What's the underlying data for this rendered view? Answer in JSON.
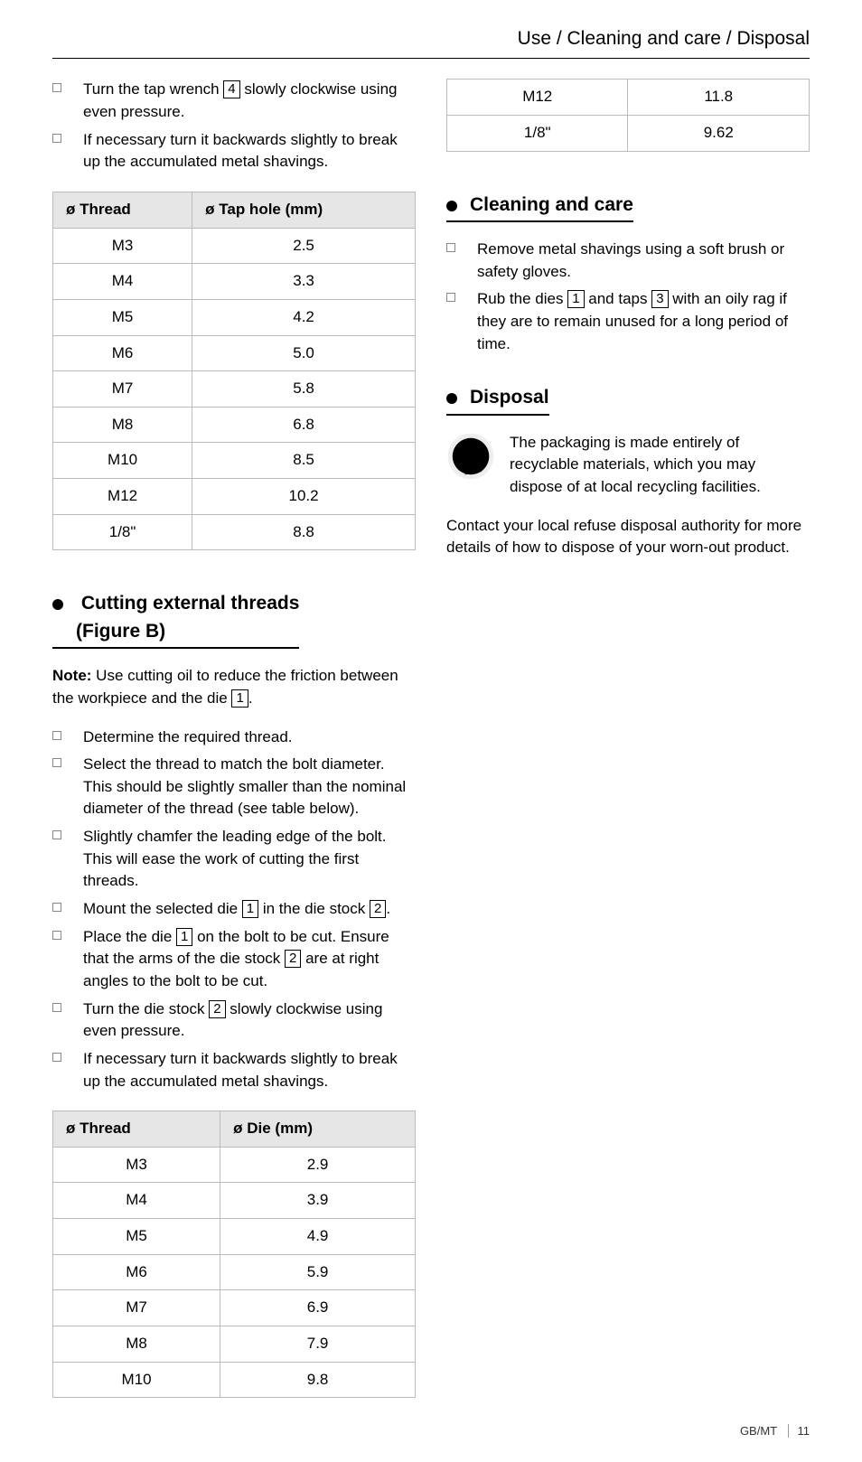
{
  "header": "Use / Cleaning and care / Disposal",
  "intro_items": [
    {
      "pre": "Turn the tap wrench ",
      "ref": "4",
      "post": " slowly clockwise using even pressure."
    },
    {
      "pre": "If necessary turn it backwards slightly to break up the accumulated metal shavings.",
      "ref": "",
      "post": ""
    }
  ],
  "tap_table": {
    "h1": "ø Thread",
    "h2": "ø Tap hole (mm)",
    "rows": [
      [
        "M3",
        "2.5"
      ],
      [
        "M4",
        "3.3"
      ],
      [
        "M5",
        "4.2"
      ],
      [
        "M6",
        "5.0"
      ],
      [
        "M7",
        "5.8"
      ],
      [
        "M8",
        "6.8"
      ],
      [
        "M10",
        "8.5"
      ],
      [
        "M12",
        "10.2"
      ],
      [
        "1/8\"",
        "8.8"
      ]
    ]
  },
  "cut_heading": "Cutting external threads",
  "cut_sub": "(Figure B)",
  "note_label": "Note:",
  "note_pre": " Use cutting oil to reduce the friction between the workpiece and the die ",
  "note_ref": "1",
  "cut_items": [
    "Determine the required thread.",
    "Select the thread to match the bolt diameter. This should be slightly smaller than the nominal diameter of the thread (see table below).",
    "Slightly chamfer the leading edge of the bolt. This will ease the work of cutting the first threads.",
    "Mount the selected die ⟦1⟧ in the die stock ⟦2⟧.",
    "Place the die ⟦1⟧ on the bolt to be cut. Ensure that the arms of the die stock ⟦2⟧ are at right angles to the bolt to be cut.",
    "Turn the die stock ⟦2⟧ slowly clockwise using even pressure.",
    "If necessary turn it backwards slightly to break up the accumulated metal shavings."
  ],
  "die_table": {
    "h1": "ø Thread",
    "h2": "ø Die (mm)",
    "rows": [
      [
        "M3",
        "2.9"
      ],
      [
        "M4",
        "3.9"
      ],
      [
        "M5",
        "4.9"
      ],
      [
        "M6",
        "5.9"
      ],
      [
        "M7",
        "6.9"
      ],
      [
        "M8",
        "7.9"
      ],
      [
        "M10",
        "9.8"
      ]
    ]
  },
  "die_overflow": [
    [
      "M12",
      "11.8"
    ],
    [
      "1/8\"",
      "9.62"
    ]
  ],
  "clean_heading": "Cleaning and care",
  "clean_items": [
    "Remove metal shavings using a soft brush or safety gloves.",
    "Rub the dies ⟦1⟧ and taps ⟦3⟧ with an oily rag if they are to remain unused for a long period of time."
  ],
  "disp_heading": "Disposal",
  "disp_text": "The packaging is made entirely of recyclable materials, which you may dispose of at local recycling facilities.",
  "disp_contact": "Contact your local refuse disposal authority for more details of how to dispose of your worn-out product.",
  "footer_loc": "GB/MT",
  "footer_page": "11",
  "chart_data": [
    {
      "type": "table",
      "title": "Tap hole sizes",
      "columns": [
        "ø Thread",
        "ø Tap hole (mm)"
      ],
      "rows": [
        [
          "M3",
          2.5
        ],
        [
          "M4",
          3.3
        ],
        [
          "M5",
          4.2
        ],
        [
          "M6",
          5.0
        ],
        [
          "M7",
          5.8
        ],
        [
          "M8",
          6.8
        ],
        [
          "M10",
          8.5
        ],
        [
          "M12",
          10.2
        ],
        [
          "1/8\"",
          8.8
        ]
      ]
    },
    {
      "type": "table",
      "title": "Die sizes",
      "columns": [
        "ø Thread",
        "ø Die (mm)"
      ],
      "rows": [
        [
          "M3",
          2.9
        ],
        [
          "M4",
          3.9
        ],
        [
          "M5",
          4.9
        ],
        [
          "M6",
          5.9
        ],
        [
          "M7",
          6.9
        ],
        [
          "M8",
          7.9
        ],
        [
          "M10",
          9.8
        ],
        [
          "M12",
          11.8
        ],
        [
          "1/8\"",
          9.62
        ]
      ]
    }
  ]
}
